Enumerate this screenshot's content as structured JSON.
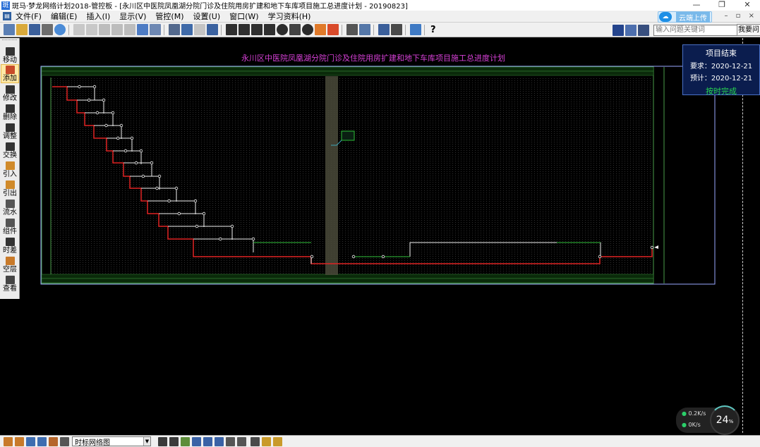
{
  "window": {
    "title": "斑马·梦龙网络计划2018-管控板 - [永川区中医院凤凰湖分院门诊及住院用房扩建和地下车库项目施工总进度计划 - 20190823]",
    "controls": [
      "—",
      "❐",
      "✕"
    ]
  },
  "menu": {
    "items": [
      "文件(F)",
      "编辑(E)",
      "插入(I)",
      "显示(V)",
      "管控(M)",
      "设置(U)",
      "窗口(W)",
      "学习资料(H)"
    ],
    "cloud_upload": "云端上传",
    "mdi_controls": "– ▫ ×"
  },
  "toolbar": {
    "help_label": "?",
    "search_placeholder": "输入问题关键词",
    "ask_button": "我要问"
  },
  "left_tools": {
    "items": [
      {
        "label": "移动",
        "icon": "cursor-icon"
      },
      {
        "label": "添加",
        "icon": "add-node-icon",
        "active": true
      },
      {
        "label": "修改",
        "icon": "pencil-icon"
      },
      {
        "label": "删除",
        "icon": "delete-icon"
      },
      {
        "label": "调整",
        "icon": "adjust-icon"
      },
      {
        "label": "交换",
        "icon": "swap-icon"
      },
      {
        "label": "引入",
        "icon": "import-icon"
      },
      {
        "label": "引出",
        "icon": "export-icon"
      },
      {
        "label": "流水",
        "icon": "flow-icon"
      },
      {
        "label": "组件",
        "icon": "component-icon"
      },
      {
        "label": "时差",
        "icon": "time-diff-icon"
      },
      {
        "label": "空层",
        "icon": "empty-layer-icon"
      },
      {
        "label": "查看",
        "icon": "view-icon"
      }
    ]
  },
  "diagram": {
    "title": "永川区中医院凤凰湖分院门诊及住院用房扩建和地下车库项目施工总进度计划",
    "colors": {
      "critical": "#e02222",
      "normal": "#f0f0f0",
      "float": "#2fbf3a",
      "grid": "#4a9c4a",
      "border": "#9aa7ff",
      "title": "#d640d6"
    }
  },
  "project_card": {
    "title": "项目结束",
    "required": "要求：2020-12-21",
    "expected": "预计：2020-12-21",
    "status": "按时完成",
    "status_color": "#27d84f"
  },
  "bottom": {
    "view_select": "时标网络图"
  },
  "speed": {
    "up": "0.2",
    "up_unit": "K/s",
    "down": "0",
    "down_unit": "K/s",
    "percent": "24",
    "percent_unit": "%"
  }
}
